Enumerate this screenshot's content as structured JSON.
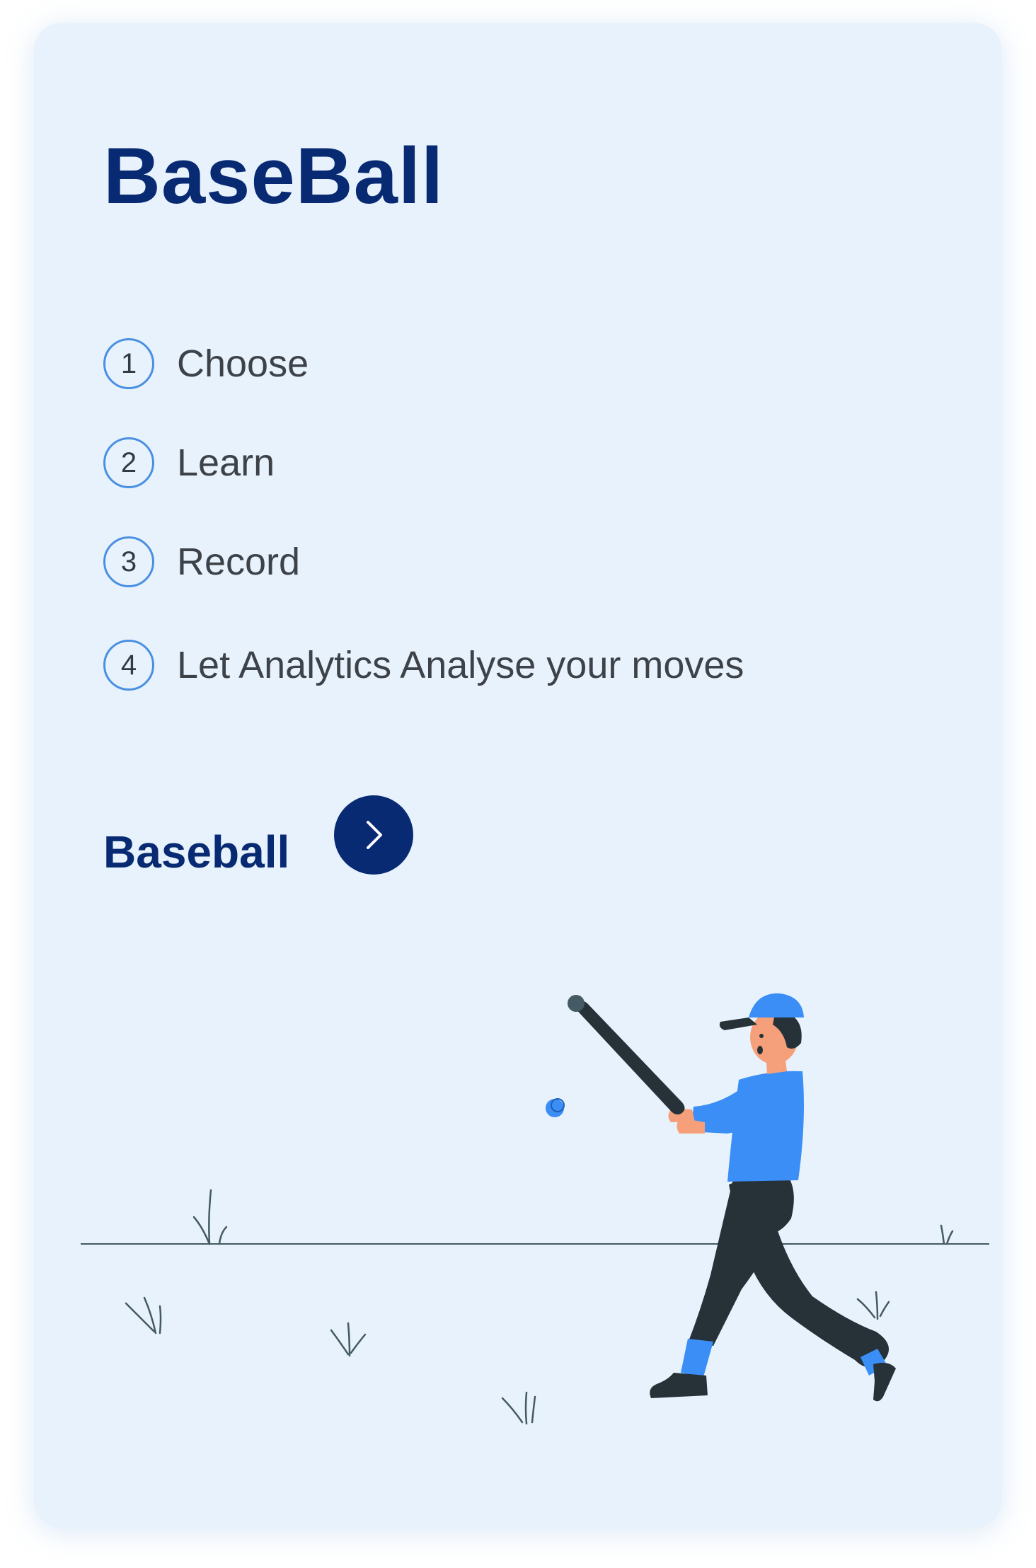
{
  "card": {
    "title": "BaseBall",
    "steps": [
      {
        "number": "1",
        "label": "Choose"
      },
      {
        "number": "2",
        "label": "Learn"
      },
      {
        "number": "3",
        "label": "Record"
      },
      {
        "number": "4",
        "label": "Let Analytics Analyse your moves"
      }
    ],
    "cta": {
      "label": "Baseball",
      "button_icon": "chevron-right-icon"
    },
    "illustration": "baseball-player-batting-illustration"
  },
  "colors": {
    "card_background": "#e8f2fc",
    "title": "#082a73",
    "accent_blue": "#3a8ef6",
    "step_ring": "#4a90e2",
    "body_text": "#3d4248",
    "player_pants": "#263238"
  }
}
